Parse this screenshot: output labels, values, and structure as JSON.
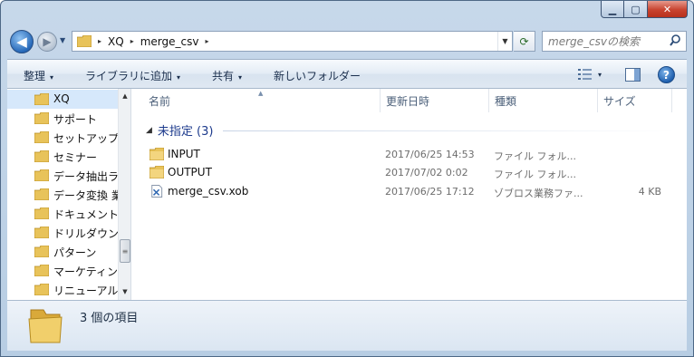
{
  "caption": {
    "minimize_icon": "minimize-icon",
    "maximize_icon": "maximize-icon",
    "close_icon": "close-icon"
  },
  "nav": {
    "back_glyph": "◀",
    "forward_glyph": "▶",
    "dropdown_glyph": "▼",
    "breadcrumbs": [
      "XQ",
      "merge_csv"
    ],
    "crumb_separator": "▸",
    "refresh_glyph": "⟳",
    "search_placeholder": "merge_csvの検索",
    "search_glyph": "⚲"
  },
  "toolbar": {
    "organize": "整理",
    "add_to_library": "ライブラリに追加",
    "share": "共有",
    "new_folder": "新しいフォルダー",
    "dropdown_glyph": "▾",
    "help_glyph": "?"
  },
  "sidebar": {
    "items": [
      {
        "label": "XQ",
        "selected": true
      },
      {
        "label": "サポート",
        "selected": false
      },
      {
        "label": "セットアップ",
        "selected": false
      },
      {
        "label": "セミナー",
        "selected": false
      },
      {
        "label": "データ抽出ラ",
        "selected": false
      },
      {
        "label": "データ変換 業",
        "selected": false
      },
      {
        "label": "ドキュメント",
        "selected": false
      },
      {
        "label": "ドリルダウン",
        "selected": false
      },
      {
        "label": "パターン",
        "selected": false
      },
      {
        "label": "マーケティン",
        "selected": false
      },
      {
        "label": "リニューアル",
        "selected": false
      }
    ],
    "scroll_up_glyph": "▲",
    "scroll_down_glyph": "▼",
    "scroll_grip_glyph": "≡"
  },
  "columns": {
    "name": "名前",
    "modified": "更新日時",
    "type": "種類",
    "size": "サイズ",
    "sort_glyph": "▲"
  },
  "group": {
    "toggle_glyph": "◢",
    "label": "未指定 (3)"
  },
  "files": [
    {
      "name": "INPUT",
      "modified": "2017/06/25 14:53",
      "type": "ファイル フォル...",
      "size": "",
      "icon": "folder-icon"
    },
    {
      "name": "OUTPUT",
      "modified": "2017/07/02 0:02",
      "type": "ファイル フォル...",
      "size": "",
      "icon": "folder-icon"
    },
    {
      "name": "merge_csv.xob",
      "modified": "2017/06/25 17:12",
      "type": "ゾブロス業務ファ...",
      "size": "4 KB",
      "icon": "xob-file-icon"
    }
  ],
  "details": {
    "count_text": "3 個の項目"
  },
  "colors": {
    "folder": "#e8c35a",
    "accent": "#2769b9",
    "selection": "#d6e8fb",
    "group_text": "#1c3a8c"
  }
}
